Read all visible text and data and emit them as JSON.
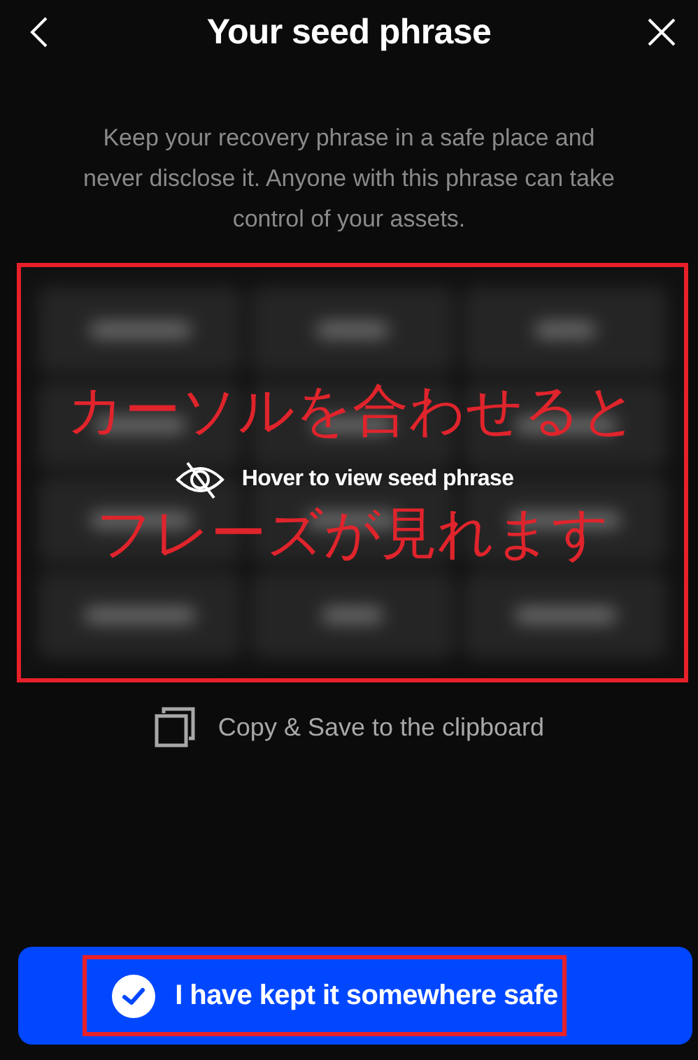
{
  "header": {
    "title": "Your seed phrase"
  },
  "description": "Keep your recovery phrase in a safe place and never disclose it. Anyone with this phrase can take control of your assets.",
  "seed_panel": {
    "hint": "Hover to view seed phrase",
    "annotation": [
      "カーソルを合わせると",
      "フレーズが見れます"
    ]
  },
  "copy_action": {
    "label": "Copy & Save to the clipboard"
  },
  "confirm_button": {
    "label": "I have kept it somewhere safe",
    "checked": true
  }
}
